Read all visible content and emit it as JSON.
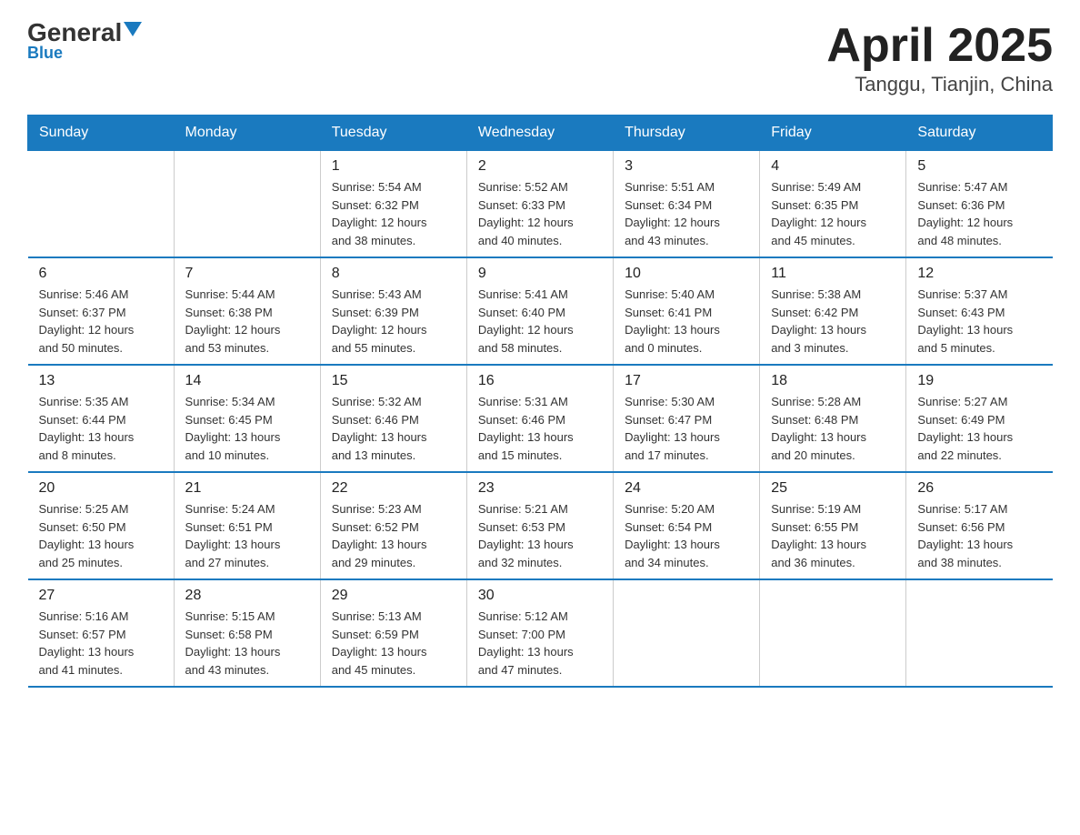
{
  "logo": {
    "general": "General",
    "blue": "Blue"
  },
  "title": "April 2025",
  "subtitle": "Tanggu, Tianjin, China",
  "days_of_week": [
    "Sunday",
    "Monday",
    "Tuesday",
    "Wednesday",
    "Thursday",
    "Friday",
    "Saturday"
  ],
  "weeks": [
    [
      {
        "day": "",
        "info": ""
      },
      {
        "day": "",
        "info": ""
      },
      {
        "day": "1",
        "info": "Sunrise: 5:54 AM\nSunset: 6:32 PM\nDaylight: 12 hours\nand 38 minutes."
      },
      {
        "day": "2",
        "info": "Sunrise: 5:52 AM\nSunset: 6:33 PM\nDaylight: 12 hours\nand 40 minutes."
      },
      {
        "day": "3",
        "info": "Sunrise: 5:51 AM\nSunset: 6:34 PM\nDaylight: 12 hours\nand 43 minutes."
      },
      {
        "day": "4",
        "info": "Sunrise: 5:49 AM\nSunset: 6:35 PM\nDaylight: 12 hours\nand 45 minutes."
      },
      {
        "day": "5",
        "info": "Sunrise: 5:47 AM\nSunset: 6:36 PM\nDaylight: 12 hours\nand 48 minutes."
      }
    ],
    [
      {
        "day": "6",
        "info": "Sunrise: 5:46 AM\nSunset: 6:37 PM\nDaylight: 12 hours\nand 50 minutes."
      },
      {
        "day": "7",
        "info": "Sunrise: 5:44 AM\nSunset: 6:38 PM\nDaylight: 12 hours\nand 53 minutes."
      },
      {
        "day": "8",
        "info": "Sunrise: 5:43 AM\nSunset: 6:39 PM\nDaylight: 12 hours\nand 55 minutes."
      },
      {
        "day": "9",
        "info": "Sunrise: 5:41 AM\nSunset: 6:40 PM\nDaylight: 12 hours\nand 58 minutes."
      },
      {
        "day": "10",
        "info": "Sunrise: 5:40 AM\nSunset: 6:41 PM\nDaylight: 13 hours\nand 0 minutes."
      },
      {
        "day": "11",
        "info": "Sunrise: 5:38 AM\nSunset: 6:42 PM\nDaylight: 13 hours\nand 3 minutes."
      },
      {
        "day": "12",
        "info": "Sunrise: 5:37 AM\nSunset: 6:43 PM\nDaylight: 13 hours\nand 5 minutes."
      }
    ],
    [
      {
        "day": "13",
        "info": "Sunrise: 5:35 AM\nSunset: 6:44 PM\nDaylight: 13 hours\nand 8 minutes."
      },
      {
        "day": "14",
        "info": "Sunrise: 5:34 AM\nSunset: 6:45 PM\nDaylight: 13 hours\nand 10 minutes."
      },
      {
        "day": "15",
        "info": "Sunrise: 5:32 AM\nSunset: 6:46 PM\nDaylight: 13 hours\nand 13 minutes."
      },
      {
        "day": "16",
        "info": "Sunrise: 5:31 AM\nSunset: 6:46 PM\nDaylight: 13 hours\nand 15 minutes."
      },
      {
        "day": "17",
        "info": "Sunrise: 5:30 AM\nSunset: 6:47 PM\nDaylight: 13 hours\nand 17 minutes."
      },
      {
        "day": "18",
        "info": "Sunrise: 5:28 AM\nSunset: 6:48 PM\nDaylight: 13 hours\nand 20 minutes."
      },
      {
        "day": "19",
        "info": "Sunrise: 5:27 AM\nSunset: 6:49 PM\nDaylight: 13 hours\nand 22 minutes."
      }
    ],
    [
      {
        "day": "20",
        "info": "Sunrise: 5:25 AM\nSunset: 6:50 PM\nDaylight: 13 hours\nand 25 minutes."
      },
      {
        "day": "21",
        "info": "Sunrise: 5:24 AM\nSunset: 6:51 PM\nDaylight: 13 hours\nand 27 minutes."
      },
      {
        "day": "22",
        "info": "Sunrise: 5:23 AM\nSunset: 6:52 PM\nDaylight: 13 hours\nand 29 minutes."
      },
      {
        "day": "23",
        "info": "Sunrise: 5:21 AM\nSunset: 6:53 PM\nDaylight: 13 hours\nand 32 minutes."
      },
      {
        "day": "24",
        "info": "Sunrise: 5:20 AM\nSunset: 6:54 PM\nDaylight: 13 hours\nand 34 minutes."
      },
      {
        "day": "25",
        "info": "Sunrise: 5:19 AM\nSunset: 6:55 PM\nDaylight: 13 hours\nand 36 minutes."
      },
      {
        "day": "26",
        "info": "Sunrise: 5:17 AM\nSunset: 6:56 PM\nDaylight: 13 hours\nand 38 minutes."
      }
    ],
    [
      {
        "day": "27",
        "info": "Sunrise: 5:16 AM\nSunset: 6:57 PM\nDaylight: 13 hours\nand 41 minutes."
      },
      {
        "day": "28",
        "info": "Sunrise: 5:15 AM\nSunset: 6:58 PM\nDaylight: 13 hours\nand 43 minutes."
      },
      {
        "day": "29",
        "info": "Sunrise: 5:13 AM\nSunset: 6:59 PM\nDaylight: 13 hours\nand 45 minutes."
      },
      {
        "day": "30",
        "info": "Sunrise: 5:12 AM\nSunset: 7:00 PM\nDaylight: 13 hours\nand 47 minutes."
      },
      {
        "day": "",
        "info": ""
      },
      {
        "day": "",
        "info": ""
      },
      {
        "day": "",
        "info": ""
      }
    ]
  ]
}
